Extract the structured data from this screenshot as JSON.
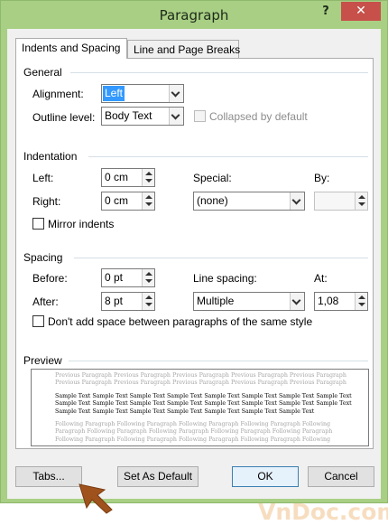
{
  "window": {
    "title": "Paragraph",
    "help_glyph": "?",
    "close_glyph": "✕"
  },
  "tabs": [
    {
      "label": "Indents and Spacing",
      "active": true
    },
    {
      "label": "Line and Page Breaks",
      "active": false
    }
  ],
  "general": {
    "title": "General",
    "alignment_label": "Alignment:",
    "alignment_value": "Left",
    "outline_label": "Outline level:",
    "outline_value": "Body Text",
    "collapsed_label": "Collapsed by default",
    "collapsed_checked": false
  },
  "indentation": {
    "title": "Indentation",
    "left_label": "Left:",
    "left_value": "0 cm",
    "right_label": "Right:",
    "right_value": "0 cm",
    "special_label": "Special:",
    "special_value": "(none)",
    "by_label": "By:",
    "by_value": "",
    "mirror_label": "Mirror indents",
    "mirror_checked": false
  },
  "spacing": {
    "title": "Spacing",
    "before_label": "Before:",
    "before_value": "0 pt",
    "after_label": "After:",
    "after_value": "8 pt",
    "line_spacing_label": "Line spacing:",
    "line_spacing_value": "Multiple",
    "at_label": "At:",
    "at_value": "1,08",
    "dont_add_label": "Don't add space between paragraphs of the same style",
    "dont_add_checked": false
  },
  "preview": {
    "title": "Preview",
    "previous_lines": [
      "Previous Paragraph Previous Paragraph Previous Paragraph Previous Paragraph Previous Paragraph",
      "Previous Paragraph Previous Paragraph Previous Paragraph Previous Paragraph Previous Paragraph"
    ],
    "sample_lines": [
      "Sample Text Sample Text Sample Text Sample Text Sample Text Sample Text Sample Text Sample Text",
      "Sample Text Sample Text Sample Text Sample Text Sample Text Sample Text Sample Text Sample Text",
      "Sample Text Sample Text Sample Text Sample Text Sample Text Sample Text Sample Text"
    ],
    "following_lines": [
      "Following Paragraph Following Paragraph Following Paragraph Following Paragraph Following",
      "Paragraph Following Paragraph Following Paragraph Following Paragraph Following Paragraph",
      "Following Paragraph Following Paragraph Following Paragraph Following Paragraph Following"
    ]
  },
  "buttons": {
    "tabs": "Tabs...",
    "set_default": "Set As Default",
    "ok": "OK",
    "cancel": "Cancel"
  },
  "watermark": {
    "text": "VnDoc.com"
  },
  "colors": {
    "window_frame": "#a8cf84",
    "close_button": "#c7504a",
    "selection": "#3399ff",
    "cursor_arrow": "#a0521d",
    "watermark": "#f2c890"
  }
}
